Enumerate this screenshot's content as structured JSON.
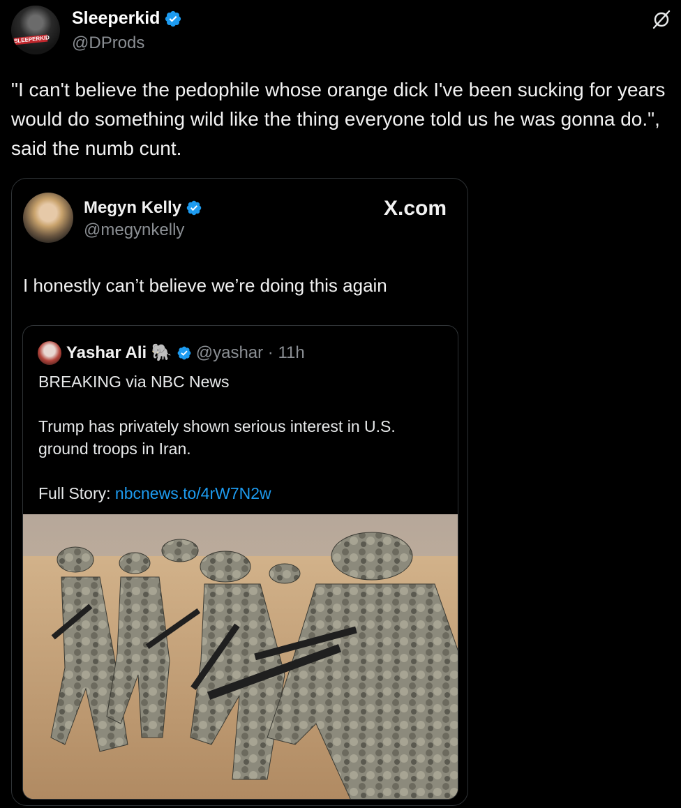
{
  "post": {
    "author_name": "Sleeperkid",
    "author_handle": "@DProds",
    "avatar_logo_text": "SLEEPERKID",
    "text": "\"I can't believe the pedophile whose orange dick I've been sucking for years would do something wild like the thing everyone told us he was gonna do.\", said the numb cunt."
  },
  "quote": {
    "author_name": "Megyn Kelly",
    "author_handle": "@megynkelly",
    "source_label": "X.com",
    "text": "I honestly can’t believe we’re doing this again",
    "inner": {
      "author_name": "Yashar Ali 🐘",
      "handle_time": "@yashar · 11h",
      "line1": "BREAKING via NBC News",
      "line2": "Trump has privately shown serious interest in U.S. ground troops in Iran.",
      "link_label": "Full Story: ",
      "link": "nbcnews.to/4rW7N2w"
    }
  },
  "colors": {
    "background": "#000000",
    "verified": "#1d9bf0",
    "link": "#1d9bf0",
    "secondary_text": "#8b8f94"
  },
  "icons": [
    "verified-badge-icon",
    "grok-icon"
  ]
}
